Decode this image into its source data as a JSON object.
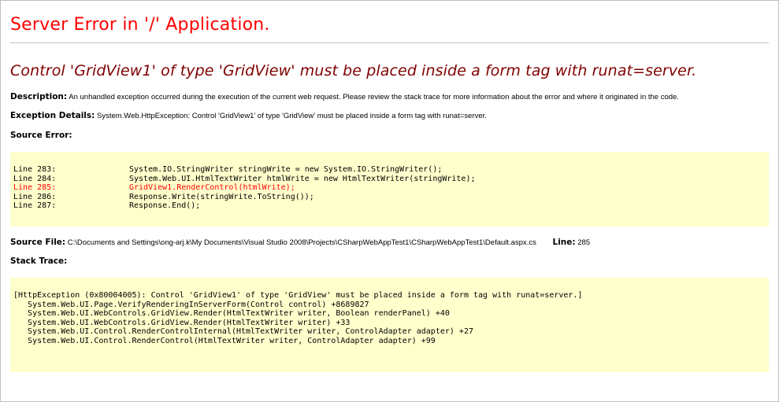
{
  "title": "Server Error in '/' Application.",
  "message": "Control 'GridView1' of type 'GridView' must be placed inside a form tag with runat=server.",
  "description": {
    "label": "Description:",
    "text": "An unhandled exception occurred during the execution of the current web request. Please review the stack trace for more information about the error and where it originated in the code."
  },
  "exception_details": {
    "label": "Exception Details:",
    "text": "System.Web.HttpException: Control 'GridView1' of type 'GridView' must be placed inside a form tag with runat=server."
  },
  "source_error": {
    "heading": "Source Error:",
    "lines": [
      {
        "num": "Line 283:",
        "code": "System.IO.StringWriter stringWrite = new System.IO.StringWriter();",
        "error": false
      },
      {
        "num": "Line 284:",
        "code": "System.Web.UI.HtmlTextWriter htmlWrite = new HtmlTextWriter(stringWrite);",
        "error": false
      },
      {
        "num": "Line 285:",
        "code": "GridView1.RenderControl(htmlWrite);",
        "error": true
      },
      {
        "num": "Line 286:",
        "code": "Response.Write(stringWrite.ToString());",
        "error": false
      },
      {
        "num": "Line 287:",
        "code": "Response.End();",
        "error": false
      }
    ]
  },
  "source_file": {
    "label": "Source File:",
    "path": "C:\\Documents and Settings\\ong-arj.k\\My Documents\\Visual Studio 2008\\Projects\\CSharpWebAppTest1\\CSharpWebAppTest1\\Default.aspx.cs",
    "line_label": "Line:",
    "line_value": "285"
  },
  "stack_trace": {
    "heading": "Stack Trace:",
    "lines": [
      "[HttpException (0x80004005): Control 'GridView1' of type 'GridView' must be placed inside a form tag with runat=server.]",
      "   System.Web.UI.Page.VerifyRenderingInServerForm(Control control) +8689827",
      "   System.Web.UI.WebControls.GridView.Render(HtmlTextWriter writer, Boolean renderPanel) +40",
      "   System.Web.UI.WebControls.GridView.Render(HtmlTextWriter writer) +33",
      "   System.Web.UI.Control.RenderControlInternal(HtmlTextWriter writer, ControlAdapter adapter) +27",
      "   System.Web.UI.Control.RenderControl(HtmlTextWriter writer, ControlAdapter adapter) +99"
    ]
  },
  "colors": {
    "title": "#ff0000",
    "message": "#800000",
    "code_background": "#ffffcc",
    "error_line": "#ff0000"
  }
}
